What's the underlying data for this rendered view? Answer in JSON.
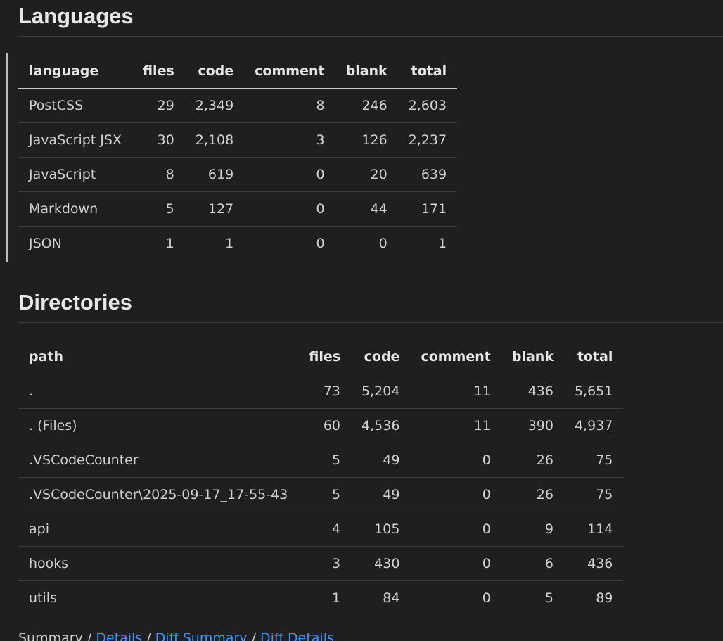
{
  "languages": {
    "title": "Languages",
    "columns": [
      "language",
      "files",
      "code",
      "comment",
      "blank",
      "total"
    ],
    "rows": [
      [
        "PostCSS",
        "29",
        "2,349",
        "8",
        "246",
        "2,603"
      ],
      [
        "JavaScript JSX",
        "30",
        "2,108",
        "3",
        "126",
        "2,237"
      ],
      [
        "JavaScript",
        "8",
        "619",
        "0",
        "20",
        "639"
      ],
      [
        "Markdown",
        "5",
        "127",
        "0",
        "44",
        "171"
      ],
      [
        "JSON",
        "1",
        "1",
        "0",
        "0",
        "1"
      ]
    ]
  },
  "directories": {
    "title": "Directories",
    "columns": [
      "path",
      "files",
      "code",
      "comment",
      "blank",
      "total"
    ],
    "rows": [
      [
        ".",
        "73",
        "5,204",
        "11",
        "436",
        "5,651"
      ],
      [
        ". (Files)",
        "60",
        "4,536",
        "11",
        "390",
        "4,937"
      ],
      [
        ".VSCodeCounter",
        "5",
        "49",
        "0",
        "26",
        "75"
      ],
      [
        ".VSCodeCounter\\2025-09-17_17-55-43",
        "5",
        "49",
        "0",
        "26",
        "75"
      ],
      [
        "api",
        "4",
        "105",
        "0",
        "9",
        "114"
      ],
      [
        "hooks",
        "3",
        "430",
        "0",
        "6",
        "436"
      ],
      [
        "utils",
        "1",
        "84",
        "0",
        "5",
        "89"
      ]
    ]
  },
  "footer": {
    "summary": "Summary",
    "sep1": " / ",
    "details": "Details",
    "sep2": " / ",
    "diff_summary": "Diff Summary",
    "sep3": " / ",
    "diff_details": "Diff Details"
  },
  "colors": {
    "background": "#1f1f1f",
    "link": "#3794ff"
  }
}
